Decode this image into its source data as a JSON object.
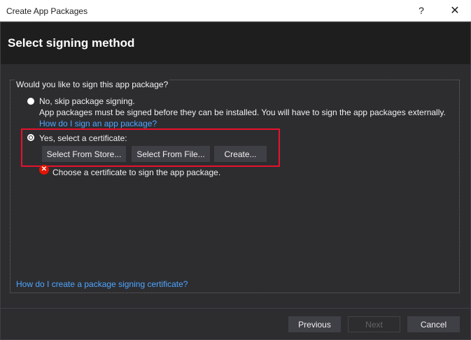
{
  "window": {
    "title": "Create App Packages",
    "help_glyph": "?",
    "close_glyph": "✕"
  },
  "header": {
    "title": "Select signing method"
  },
  "content": {
    "question": "Would you like to sign this app package?",
    "option_skip": {
      "label": "No, skip package signing.",
      "description": "App packages must be signed before they can be installed. You will have to sign the app packages externally.",
      "help_link": "How do I sign an app package?",
      "selected": false
    },
    "option_certificate": {
      "label": "Yes, select a certificate:",
      "selected": true,
      "buttons": {
        "select_from_store": "Select From Store...",
        "select_from_file": "Select From File...",
        "create": "Create..."
      }
    },
    "error_message": "Choose a certificate to sign the app package.",
    "bottom_link": "How do I create a package signing certificate?"
  },
  "footer": {
    "previous": "Previous",
    "next": "Next",
    "cancel": "Cancel"
  },
  "colors": {
    "background": "#2d2d30",
    "header_background": "#1e1e1e",
    "link": "#4fa6ff",
    "highlight_border": "#e8112d",
    "error": "#e51400"
  }
}
